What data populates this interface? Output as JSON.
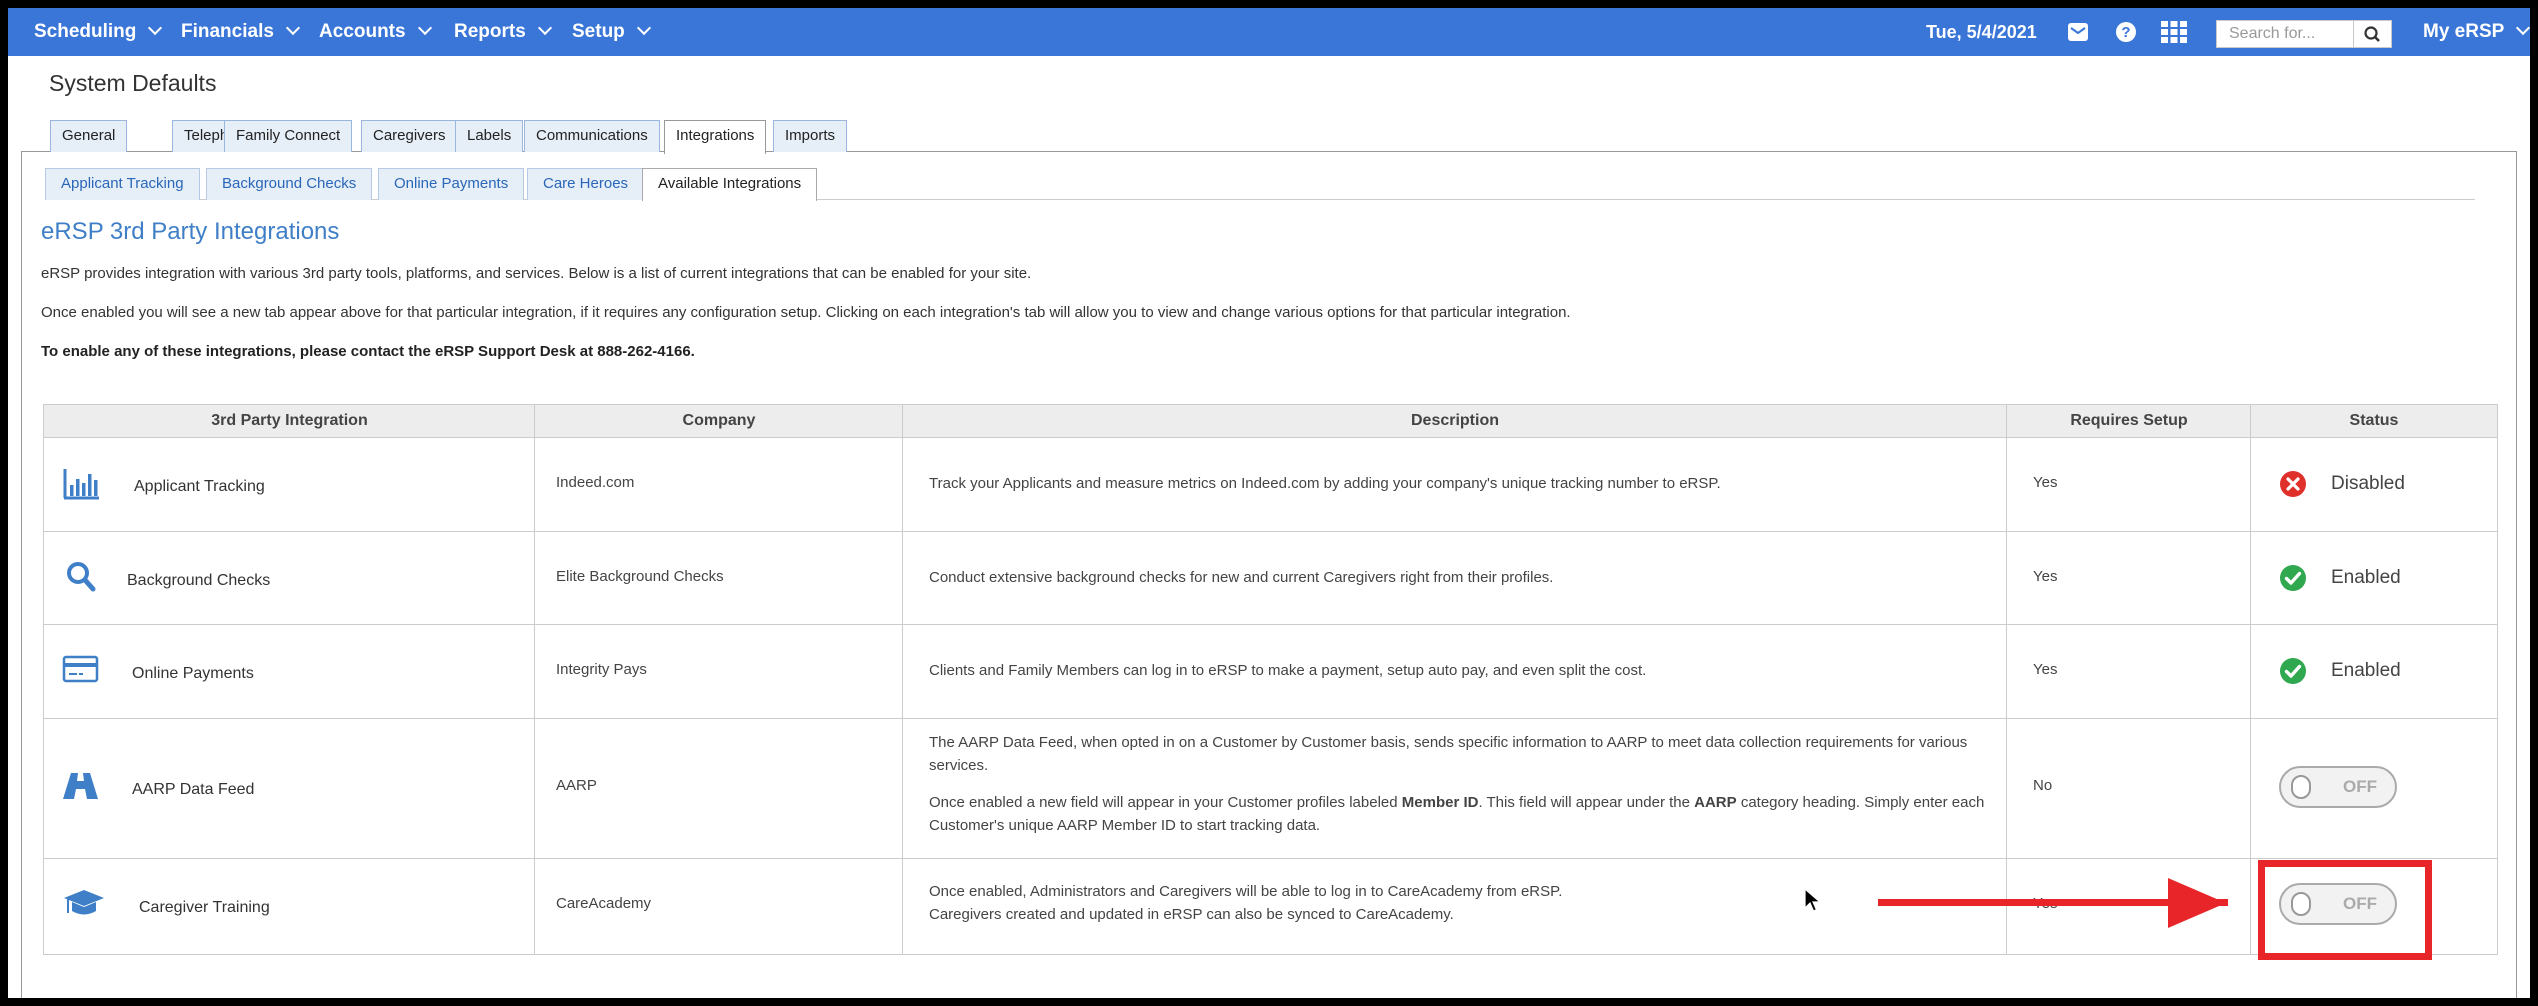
{
  "topnav": {
    "menus": [
      {
        "label": "Scheduling"
      },
      {
        "label": "Financials"
      },
      {
        "label": "Accounts"
      },
      {
        "label": "Reports"
      },
      {
        "label": "Setup"
      }
    ],
    "date": "Tue, 5/4/2021",
    "icons": [
      "mail-icon",
      "help-icon",
      "apps-grid-icon"
    ],
    "search_placeholder": "Search for...",
    "account_label": "My eRSP",
    "bar_color": "#3a76d8"
  },
  "page_title": "System Defaults",
  "tabs": [
    {
      "label": "General"
    },
    {
      "label": "Telephony"
    },
    {
      "label": "Family Connect"
    },
    {
      "label": "Caregivers"
    },
    {
      "label": "Labels"
    },
    {
      "label": "Communications"
    },
    {
      "label": "Integrations",
      "active": true
    },
    {
      "label": "Imports"
    }
  ],
  "subtabs": [
    {
      "label": "Applicant Tracking"
    },
    {
      "label": "Background Checks"
    },
    {
      "label": "Online Payments"
    },
    {
      "label": "Care Heroes"
    },
    {
      "label": "Available Integrations",
      "active": true
    }
  ],
  "section": {
    "title": "eRSP 3rd Party Integrations",
    "intro_1": "eRSP provides integration with various 3rd party tools, platforms, and services. Below is a list of current integrations that can be enabled for your site.",
    "intro_2": "Once enabled you will see a new tab appear above for that particular integration, if it requires any configuration setup. Clicking on each integration's tab will allow you to view and change various options for that particular integration.",
    "intro_3": "To enable any of these integrations, please contact the eRSP Support Desk at 888-262-4166."
  },
  "table": {
    "headers": [
      "3rd Party Integration",
      "Company",
      "Description",
      "Requires Setup",
      "Status"
    ],
    "rows": [
      {
        "icon": "bar-chart-icon",
        "name": "Applicant Tracking",
        "company": "Indeed.com",
        "description": "Track your Applicants and measure metrics on Indeed.com by adding your company's unique tracking number to eRSP.",
        "requires_setup": "Yes",
        "status": "Disabled",
        "status_color": "#e0302c"
      },
      {
        "icon": "magnifier-icon",
        "name": "Background Checks",
        "company": "Elite Background Checks",
        "description": "Conduct extensive background checks for new and current Caregivers right from their profiles.",
        "requires_setup": "Yes",
        "status": "Enabled",
        "status_color": "#2fa84f"
      },
      {
        "icon": "credit-card-icon",
        "name": "Online Payments",
        "company": "Integrity Pays",
        "description": "Clients and Family Members can log in to eRSP to make a payment, setup auto pay, and even split the cost.",
        "requires_setup": "Yes",
        "status": "Enabled",
        "status_color": "#2fa84f"
      },
      {
        "icon": "road-icon",
        "name": "AARP Data Feed",
        "company": "AARP",
        "description_p1": "The AARP Data Feed, when opted in on a Customer by Customer basis, sends specific information to AARP to meet data collection requirements for various services.",
        "description_p2_a": "Once enabled a new field will appear in your Customer profiles labeled ",
        "description_p2_b": "Member ID",
        "description_p2_c": ". This field will appear under the ",
        "description_p2_d": "AARP",
        "description_p2_e": " category heading. Simply enter each Customer's unique AARP Member ID to start tracking data.",
        "requires_setup": "No",
        "status": "OFF"
      },
      {
        "icon": "graduation-cap-icon",
        "name": "Caregiver Training",
        "company": "CareAcademy",
        "description_l1": "Once enabled, Administrators and Caregivers will be able to log in to CareAcademy from eRSP.",
        "description_l2": "Caregivers created and updated in eRSP can also be synced to CareAcademy.",
        "requires_setup": "Yes",
        "status": "OFF"
      }
    ]
  },
  "annotation_color": "#e8262a"
}
